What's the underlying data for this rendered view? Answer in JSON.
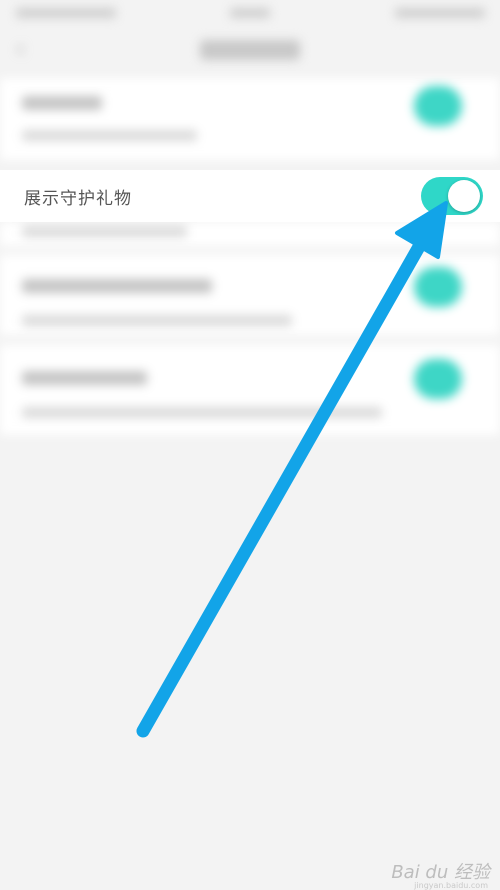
{
  "setting": {
    "label": "展示守护礼物",
    "toggle_state": "on"
  },
  "colors": {
    "accent": "#2fd7c8",
    "arrow": "#12a4e8",
    "background": "#f3f3f3"
  },
  "icons": {
    "back": "back-arrow-icon"
  },
  "watermark": {
    "text": "Bai du 经验",
    "subtext": "jingyan.baidu.com"
  }
}
